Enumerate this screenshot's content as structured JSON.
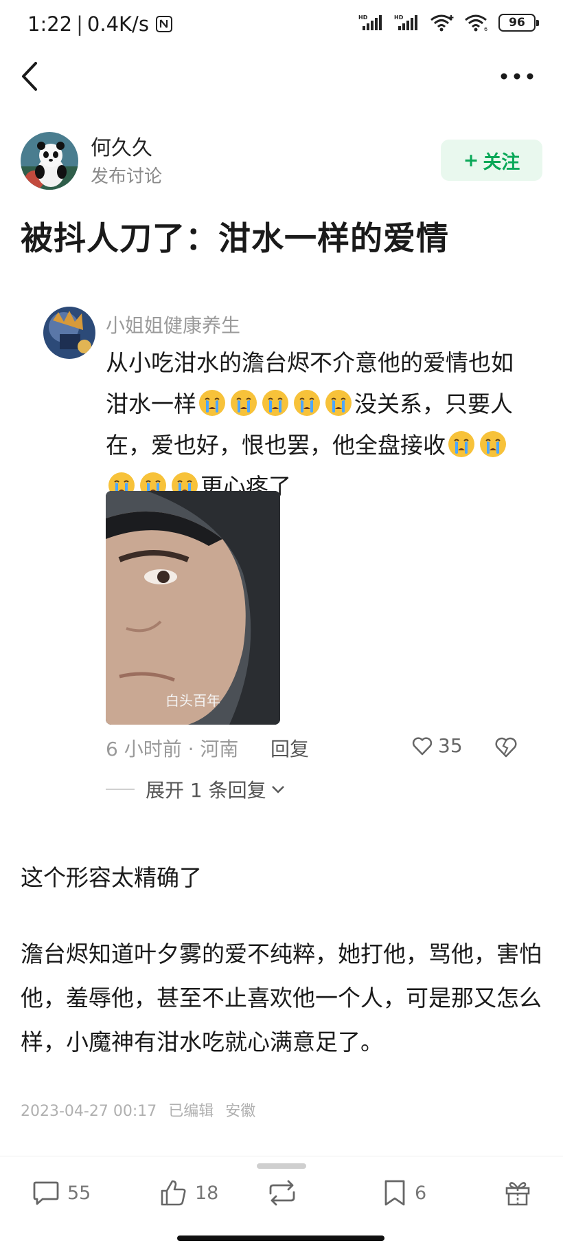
{
  "status_bar": {
    "time": "1:22",
    "speed": "0.4K/s",
    "battery": "96"
  },
  "author": {
    "name": "何久久",
    "subtitle": "发布讨论",
    "follow_label": "关注"
  },
  "post": {
    "title": "被抖人刀了：泔水一样的爱情",
    "paragraph1": "这个形容太精确了",
    "paragraph2": "澹台烬知道叶夕雾的爱不纯粹，她打他，骂他，害怕他，羞辱他，甚至不止喜欢他一个人，可是那又怎么样，小魔神有泔水吃就心满意足了。",
    "date": "2023-04-27 00:17",
    "edited": "已编辑",
    "location": "安徽"
  },
  "quoted_comment": {
    "username": "小姐姐健康养生",
    "text_part1": "从小吃泔水的澹台烬不介意他的爱情也如泔水一样",
    "text_part2": "没关系，只要人在，爱也好，恨也罢，他全盘接收",
    "text_part3": "更心疼了",
    "emoji_name": "loudly-crying-face",
    "image_caption": "白头百年",
    "time_location": "6 小时前 · 河南",
    "reply_label": "回复",
    "like_count": "35",
    "expand_label": "展开 1 条回复"
  },
  "actions": {
    "comments": "55",
    "likes": "18",
    "bookmarks": "6"
  },
  "colors": {
    "accent": "#0aa858",
    "follow_bg": "#e9f8ee",
    "muted": "#9a9a9a"
  }
}
